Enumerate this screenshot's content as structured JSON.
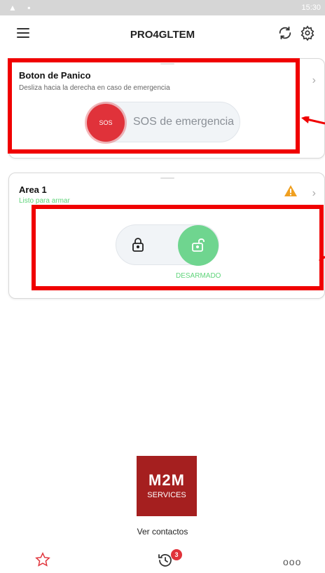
{
  "statusbar": {
    "time": "15:30",
    "icons": [
      "warning-icon",
      "notification-icon"
    ]
  },
  "header": {
    "title": "PRO4GLTEM",
    "icons": [
      "menu-icon",
      "refresh-icon",
      "settings-icon"
    ]
  },
  "panic_card": {
    "title": "Boton de Panico",
    "subtitle": "Desliza hacia la derecha en caso de emergencia",
    "knob_label": "SOS",
    "slider_text": "SOS de emergencia"
  },
  "area_card": {
    "title": "Area 1",
    "status": "Listo para armar",
    "state_label": "DESARMADO",
    "icons": [
      "warning-icon",
      "lock-icon",
      "unlock-icon",
      "chevron-right-icon"
    ]
  },
  "footer": {
    "logo_line1": "M2M",
    "logo_line2": "SERVICES",
    "contacts_link": "Ver contactos"
  },
  "bottom_nav": {
    "badge_count": "3",
    "icons": [
      "star-icon",
      "history-icon",
      "more-icon"
    ],
    "more_label": "ooo"
  },
  "colors": {
    "accent_red": "#e0323a",
    "accent_green": "#6fd58f",
    "annotation_red": "#f00000",
    "logo_red": "#a51f1f"
  }
}
